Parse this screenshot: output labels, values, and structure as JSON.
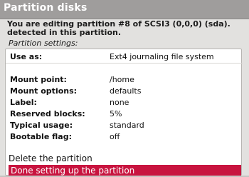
{
  "window": {
    "title": "Partition disks"
  },
  "intro": {
    "text": "You are editing partition #8 of SCSI3 (0,0,0) (sda).\ndetected in this partition."
  },
  "settings": {
    "heading": "Partition settings:",
    "rows": [
      {
        "label": "Use as:",
        "value": "Ext4 journaling file system"
      },
      {
        "label": "Mount point:",
        "value": "/home"
      },
      {
        "label": "Mount options:",
        "value": "defaults"
      },
      {
        "label": "Label:",
        "value": "none"
      },
      {
        "label": "Reserved blocks:",
        "value": "5%"
      },
      {
        "label": "Typical usage:",
        "value": "standard"
      },
      {
        "label": "Bootable flag:",
        "value": "off"
      }
    ]
  },
  "actions": {
    "delete": "Delete the partition",
    "done": "Done setting up the partition"
  },
  "colors": {
    "title_bar": "#9f9d9c",
    "selection": "#c8143f",
    "panel_bg": "#ffffff",
    "screen_bg": "#e2e1df"
  }
}
